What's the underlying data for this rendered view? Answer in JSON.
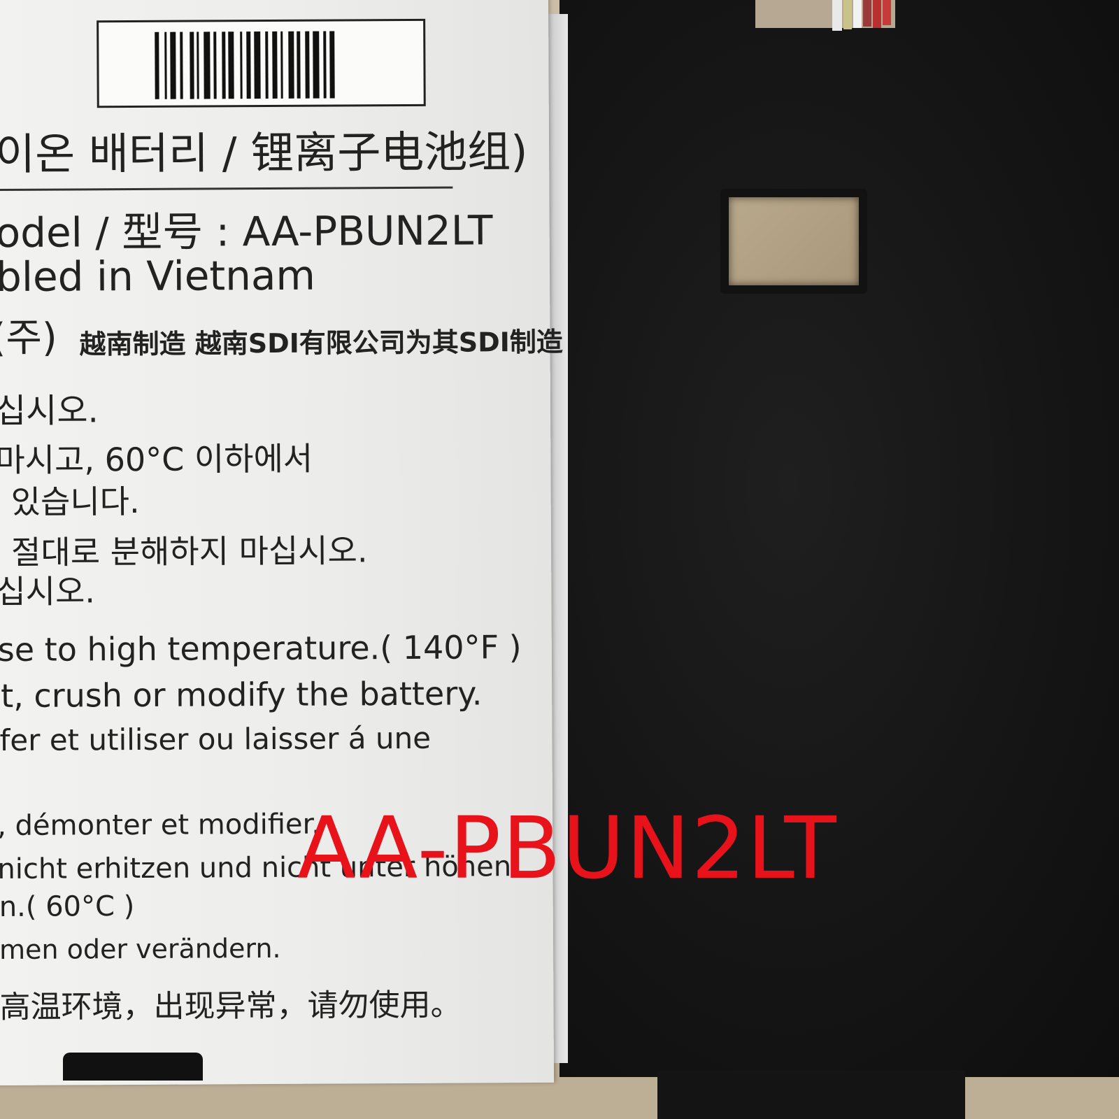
{
  "label": {
    "title_line": "이온 배터리 / 锂离子电池组)",
    "model_line": "odel / 型号  : AA-PBUN2LT",
    "assembled_line": "bled in Vietnam",
    "maker_line_kr": "(주)",
    "maker_line_cn": "越南制造 越南SDI有限公司为其SDI制造",
    "korean_lines": [
      "십시오.",
      "마시고, 60°C 이하에서",
      "있습니다.",
      "절대로 분해하지 마십시오.",
      "십시오."
    ],
    "english_lines": [
      "se to high temperature.( 140°F )",
      "t, crush or modify the battery."
    ],
    "french_lines": [
      "fer et utiliser ou laisser á une",
      ", démonter et modifier."
    ],
    "german_lines": [
      "nicht erhitzen und nicht unter höhen",
      "n.( 60°C )",
      "men oder verändern."
    ],
    "chinese_line": "高温环境，出现异常，请勿使用。"
  },
  "watermark": {
    "text": "AA-PBUN2LT",
    "color": "#e8121a"
  }
}
